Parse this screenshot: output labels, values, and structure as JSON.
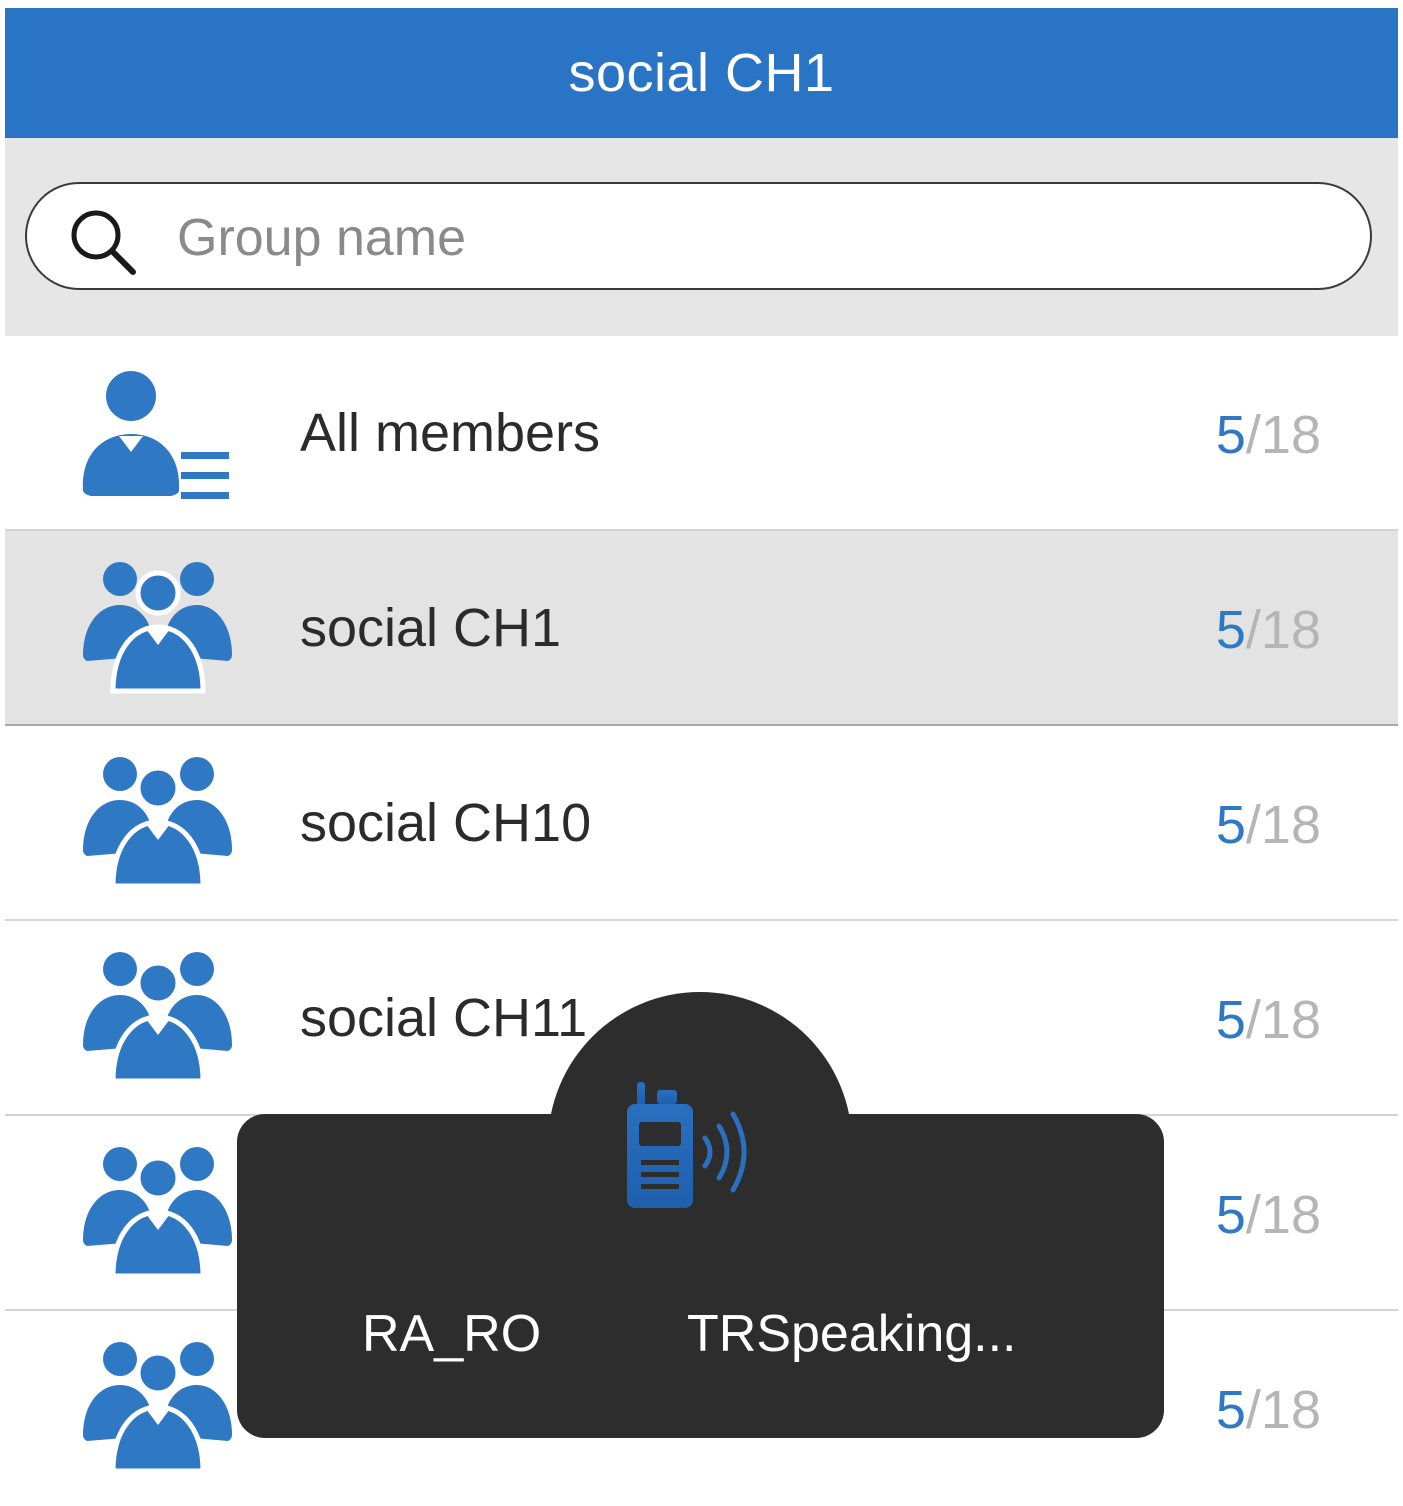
{
  "header": {
    "title": "social CH1"
  },
  "search": {
    "placeholder": "Group name",
    "value": ""
  },
  "groups": [
    {
      "label": "All members",
      "online": "5",
      "total": "/18",
      "icon": "member-list-icon"
    },
    {
      "label": "social CH1",
      "online": "5",
      "total": "/18",
      "icon": "group-icon",
      "selected": true
    },
    {
      "label": "social CH10",
      "online": "5",
      "total": "/18",
      "icon": "group-icon"
    },
    {
      "label": "social CH11",
      "online": "5",
      "total": "/18",
      "icon": "group-icon"
    },
    {
      "label": "",
      "online": "5",
      "total": "/18",
      "icon": "group-icon"
    },
    {
      "label": "",
      "online": "5",
      "total": "/18",
      "icon": "group-icon"
    }
  ],
  "ptt": {
    "user": "RA_RO",
    "status": "TRSpeaking...",
    "icon": "walkie-talkie-icon"
  },
  "colors": {
    "header_bg": "#2a74c5",
    "accent": "#2f78c4",
    "count_total": "#b5b5b5",
    "overlay_bg": "#2d2d2d"
  }
}
